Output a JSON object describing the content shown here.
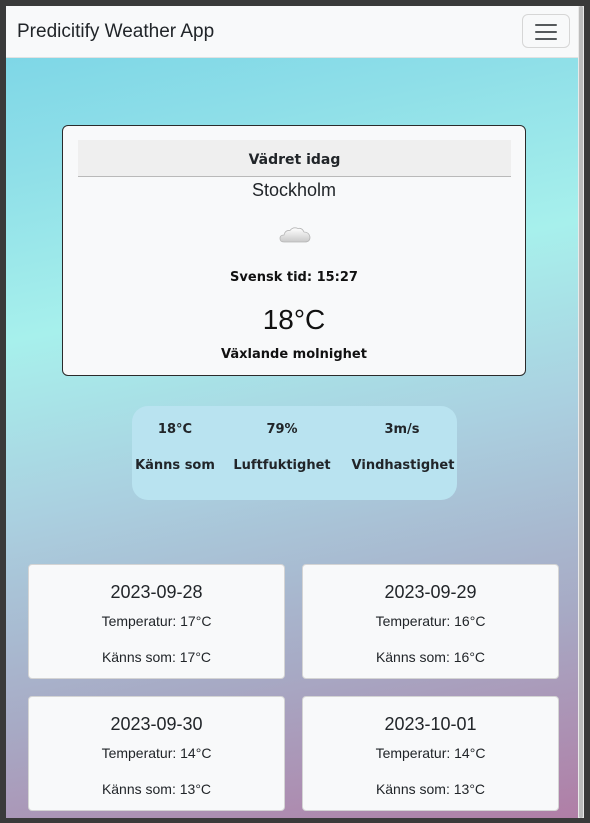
{
  "navbar": {
    "brand": "Predicitify Weather App",
    "menu_icon": "hamburger-menu-icon"
  },
  "today": {
    "header": "Vädret idag",
    "city": "Stockholm",
    "icon": "cloud-icon",
    "swedish_time": "Svensk tid: 15:27",
    "temperature": "18°C",
    "description": "Växlande molnighet"
  },
  "stats": {
    "feels_like": {
      "value": "18°C",
      "label": "Känns som"
    },
    "humidity": {
      "value": "79%",
      "label": "Luftfuktighet"
    },
    "wind": {
      "value": "3m/s",
      "label": "Vindhastighet"
    }
  },
  "forecast": [
    {
      "date": "2023-09-28",
      "temperature": "Temperatur: 17°C",
      "feels_like": "Känns som: 17°C"
    },
    {
      "date": "2023-09-29",
      "temperature": "Temperatur: 16°C",
      "feels_like": "Känns som: 16°C"
    },
    {
      "date": "2023-09-30",
      "temperature": "Temperatur: 14°C",
      "feels_like": "Känns som: 13°C"
    },
    {
      "date": "2023-10-01",
      "temperature": "Temperatur: 14°C",
      "feels_like": "Känns som: 13°C"
    }
  ]
}
